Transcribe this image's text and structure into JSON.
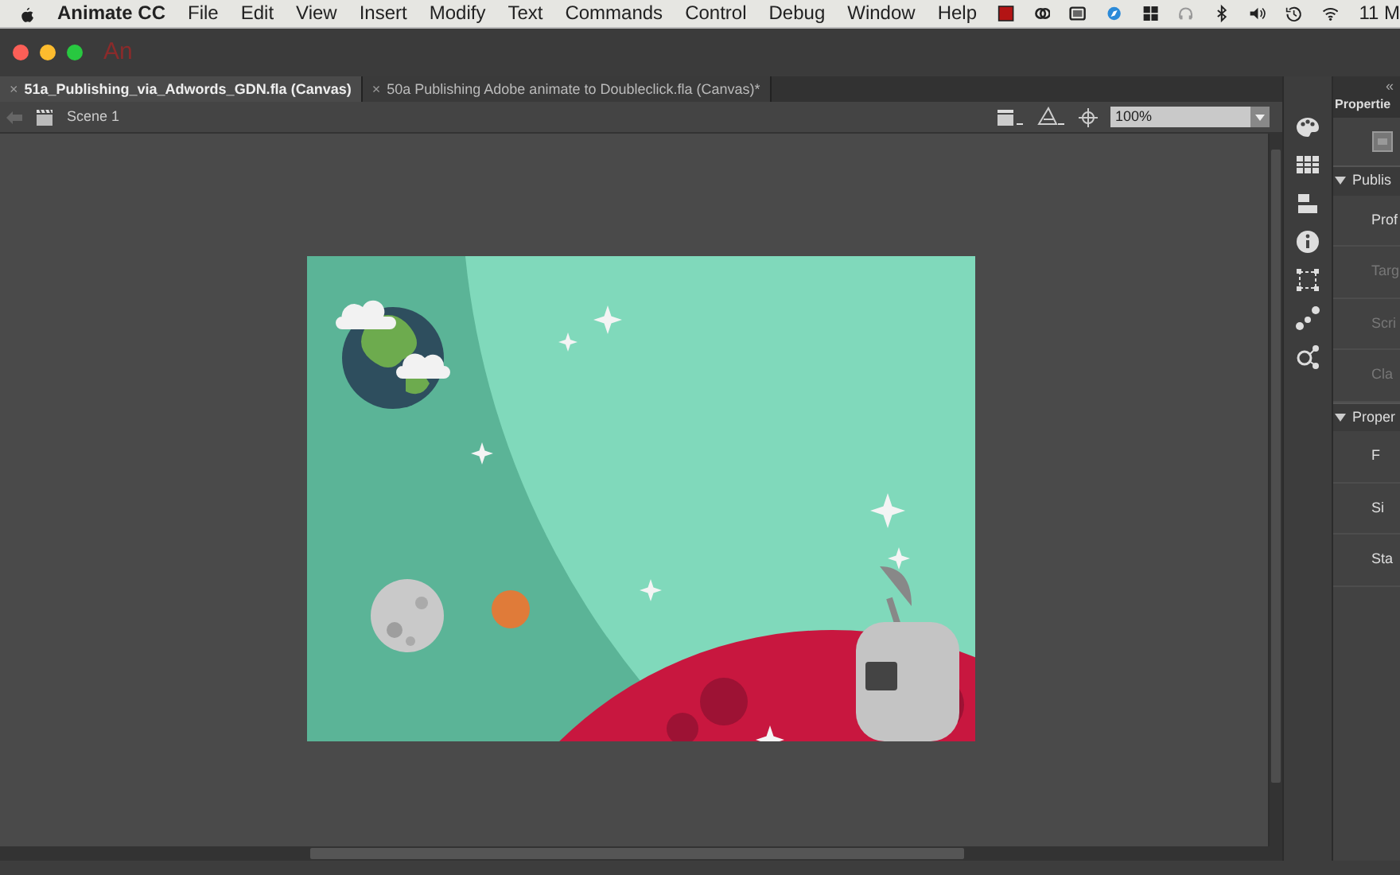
{
  "menu_bar": {
    "app_name": "Animate CC",
    "items": [
      "File",
      "Edit",
      "View",
      "Insert",
      "Modify",
      "Text",
      "Commands",
      "Control",
      "Debug",
      "Window",
      "Help"
    ],
    "clock": "11 M"
  },
  "window": {
    "logo": "An"
  },
  "tabs": [
    {
      "label": "51a_Publishing_via_Adwords_GDN.fla (Canvas)",
      "selected": true,
      "close": "×"
    },
    {
      "label": "50a Publishing Adobe animate to Doubleclick.fla (Canvas)*",
      "selected": false,
      "close": "×"
    }
  ],
  "scene_bar": {
    "scene": "Scene 1",
    "zoom": "100%"
  },
  "properties_panel": {
    "title": "Propertie",
    "collapse": "«",
    "sections": [
      {
        "title": "Publis",
        "expanded": true,
        "rows": [
          {
            "label": "Prof",
            "disabled": false
          },
          {
            "label": "Targ",
            "disabled": true
          },
          {
            "label": "Scri",
            "disabled": true
          },
          {
            "label": "Cla",
            "disabled": true
          }
        ]
      },
      {
        "title": "Proper",
        "expanded": true,
        "rows": [
          {
            "label": "F",
            "disabled": false
          },
          {
            "label": "Si",
            "disabled": false
          },
          {
            "label": "Sta",
            "disabled": false
          }
        ]
      }
    ]
  }
}
